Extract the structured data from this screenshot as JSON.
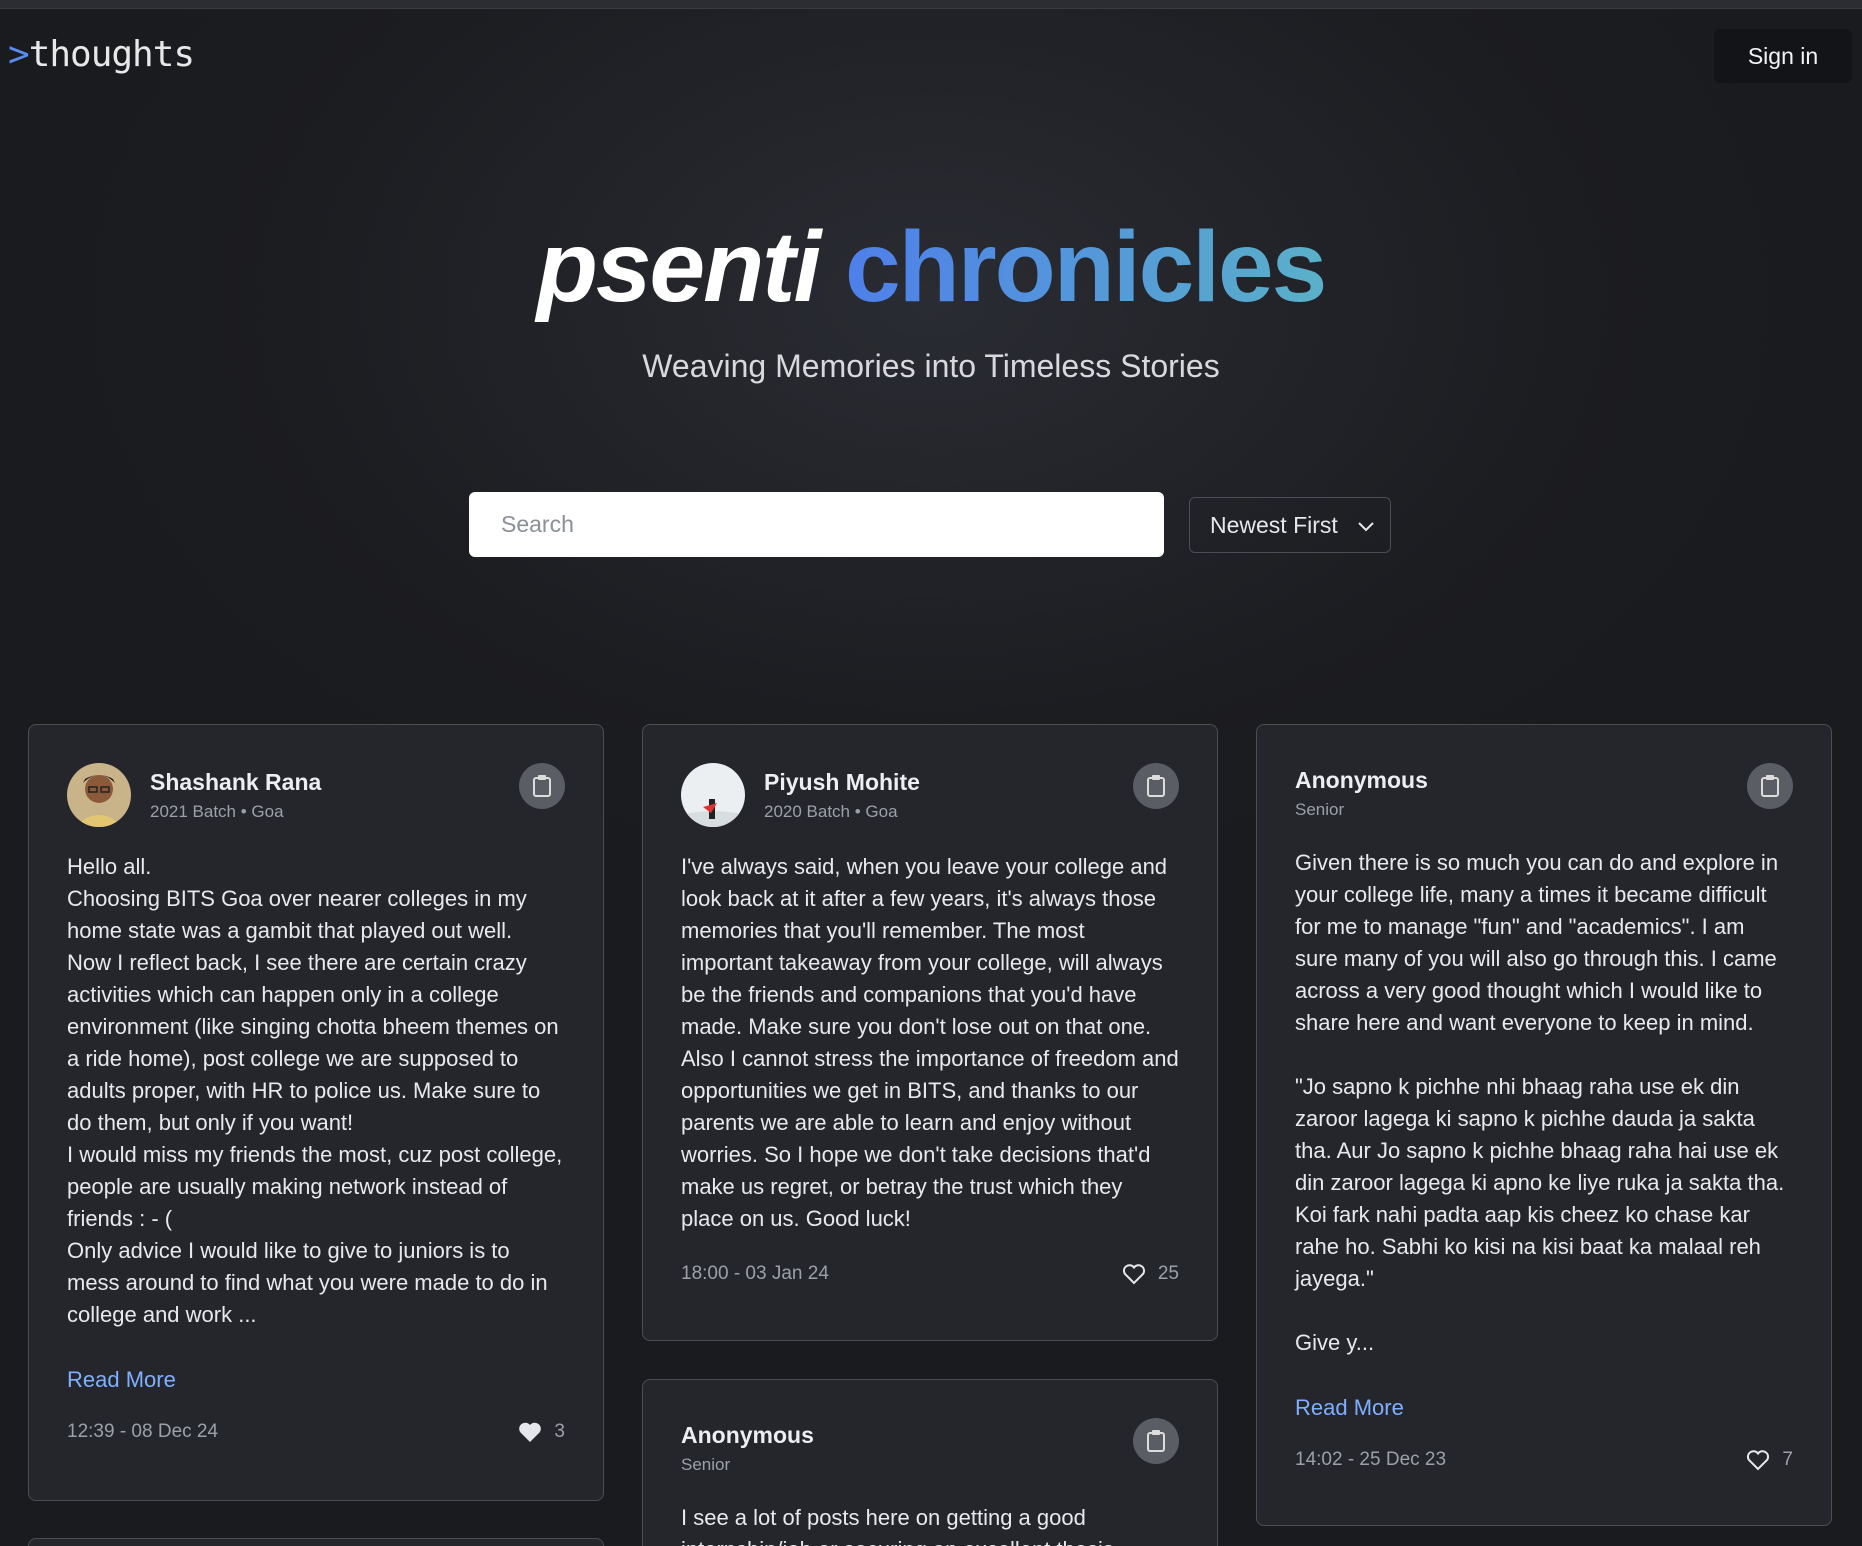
{
  "header": {
    "logo_prefix": ">",
    "logo_text": "thoughts",
    "signin_label": "Sign in"
  },
  "hero": {
    "title_part1": "psenti",
    "title_part2": "chronicles",
    "subtitle": "Weaving Memories into Timeless Stories"
  },
  "controls": {
    "search_placeholder": "Search",
    "sort_value": "Newest First"
  },
  "colors": {
    "accent_blue": "#4f7fea",
    "accent_teal": "#5ab0c9",
    "link": "#7fb0ff",
    "card_bg": "#24262c"
  },
  "posts": [
    {
      "author": "Shashank Rana",
      "meta": "2021 Batch • Goa",
      "body": "Hello all.\nChoosing BITS Goa over nearer colleges in my home state was a gambit that played out well.\nNow I reflect back, I see there are certain crazy activities which can happen only in a college environment (like singing chotta bheem themes on a ride home), post college we are supposed to adults proper, with HR to police us. Make sure to do them, but only if you want!\nI would miss my friends the most, cuz post college, people are usually making network instead of friends : - (\nOnly advice I would like to give to juniors is to mess around to find what you were made to do in college and work ...",
      "read_more": "Read More",
      "timestamp": "12:39 - 08 Dec 24",
      "likes": "3"
    },
    {
      "author": "Piyush Mohite",
      "meta": "2020 Batch • Goa",
      "body": "I've always said, when you leave your college and look back at it after a few years, it's always those memories that you'll remember. The most important takeaway from your college, will always be the friends and companions that you'd have made. Make sure you don't lose out on that one. Also I cannot stress the importance of freedom and opportunities we get in BITS, and thanks to our parents we are able to learn and enjoy without worries. So I hope we don't take decisions that'd make us regret, or betray the trust which they place on us. Good luck!",
      "timestamp": "18:00 - 03 Jan 24",
      "likes": "25"
    },
    {
      "author": "Anonymous",
      "meta": "Senior",
      "body": "Given there is so much you can do and explore in your college life, many a times it became difficult for me to manage \"fun\" and \"academics\". I am sure many of you will also go through this. I came across a very good thought which I would like to share here and want everyone to keep in mind.\n\n\"Jo sapno k pichhe nhi bhaag raha use ek din zaroor lagega ki sapno k pichhe dauda ja sakta tha. Aur Jo sapno k pichhe bhaag raha hai use ek din zaroor lagega ki apno ke liye ruka ja sakta tha. Koi fark nahi padta aap kis cheez ko chase kar rahe ho. Sabhi ko kisi na kisi baat ka malaal reh jayega.\"\n\nGive y...",
      "read_more": "Read More",
      "timestamp": "14:02 - 25 Dec 23",
      "likes": "7"
    },
    {
      "author": "Anonymous",
      "meta": "Senior",
      "body": "I see a lot of posts here on getting a good internship/job or securing an excellent thesis"
    }
  ]
}
